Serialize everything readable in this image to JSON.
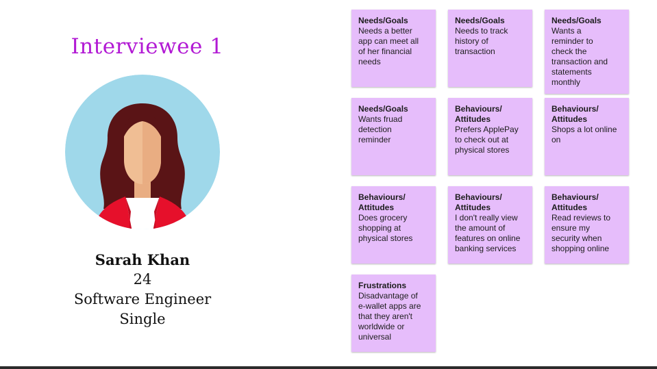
{
  "title": "Interviewee 1",
  "profile": {
    "name": "Sarah Khan",
    "age": "24",
    "occupation": "Software Engineer",
    "status": "Single"
  },
  "colors": {
    "title": "#b21ad4",
    "note": "#e6bdfb",
    "avatar_bg": "#9fd8ea",
    "hair": "#5a1416",
    "jacket": "#e6102b",
    "skin": "#f0be94"
  },
  "notes": [
    {
      "category": "Needs/Goals",
      "text": "Needs a better\napp can meet all\nof her financial\nneeds"
    },
    {
      "category": "Needs/Goals",
      "text": "Needs to track\nhistory of\ntransaction"
    },
    {
      "category": "Needs/Goals",
      "text": " Wants a\nreminder to\ncheck the\ntransaction and\nstatements\nmonthly"
    },
    {
      "category": "Needs/Goals",
      "text": "Wants fruad\ndetection\nreminder"
    },
    {
      "category": "Behaviours/\nAttitudes",
      "text": "Prefers ApplePay\nto check out at\nphysical stores"
    },
    {
      "category": "Behaviours/\nAttitudes",
      "text": "Shops a lot online\non"
    },
    {
      "category": "Behaviours/\nAttitudes",
      "text": "Does grocery\nshopping at\nphysical stores"
    },
    {
      "category": "Behaviours/\nAttitudes",
      "text": "I don't really view\nthe amount of\nfeatures on online\nbanking services"
    },
    {
      "category": "Behaviours/\nAttitudes",
      "text": "Read reviews to\nensure my\nsecurity when\nshopping online"
    },
    {
      "category": "Frustrations",
      "text": "Disadvantage of\ne-wallet apps are\nthat they aren't\nworldwide or\nuniversal"
    }
  ]
}
